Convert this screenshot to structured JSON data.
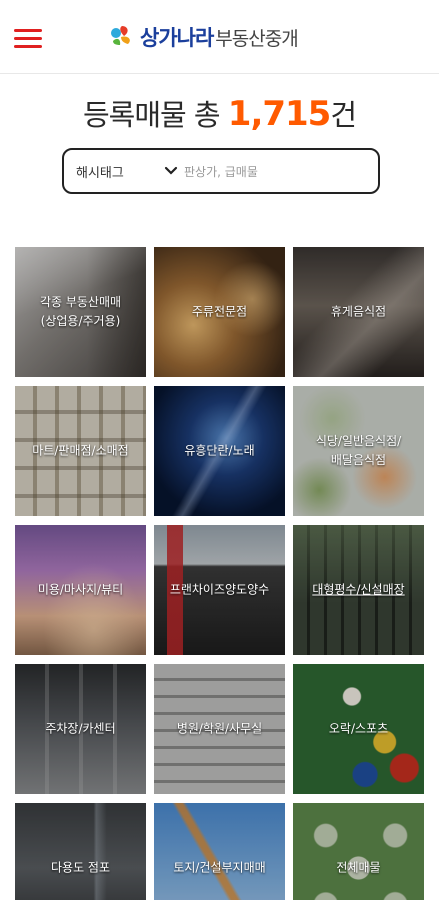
{
  "header": {
    "menu_icon": "hamburger-menu-icon",
    "logo_main": "상가나라",
    "logo_sub": "부동산중개",
    "menu_color": "#e02020"
  },
  "summary": {
    "prefix": "등록매물 총 ",
    "count": "1,715",
    "suffix": "건",
    "accent_color": "#ff5a00"
  },
  "search": {
    "select_value": "해시태그",
    "placeholder": "판상가, 급매물"
  },
  "categories": [
    {
      "label": "각종 부동산매매\n(상업용/주거용)"
    },
    {
      "label": "주류전문점"
    },
    {
      "label": "휴게음식점"
    },
    {
      "label": "마트/판매점/소매점"
    },
    {
      "label": "유흥단란/노래"
    },
    {
      "label": "식당/일반음식점/\n배달음식점"
    },
    {
      "label": "미용/마사지/뷰티"
    },
    {
      "label": "프랜차이즈양도양수"
    },
    {
      "label": "대형평수/신설매장"
    },
    {
      "label": "주차장/카센터"
    },
    {
      "label": "병원/학원/사무실"
    },
    {
      "label": "오락/스포츠"
    },
    {
      "label": "다용도 점포"
    },
    {
      "label": "토지/건설부지매매"
    },
    {
      "label": "전체매물"
    }
  ]
}
